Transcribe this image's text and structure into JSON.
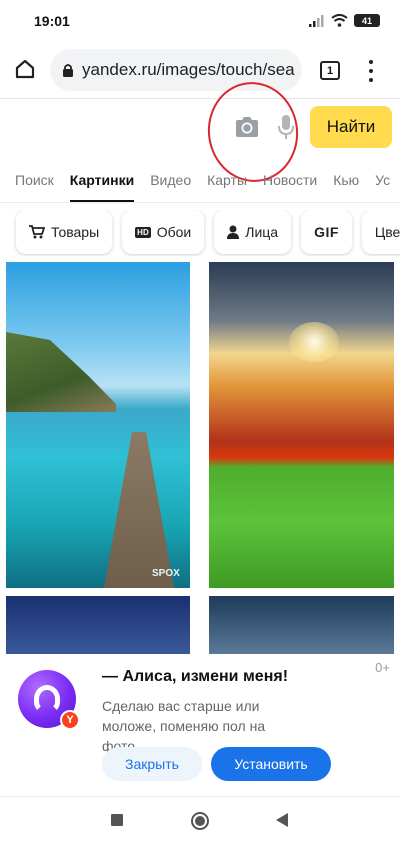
{
  "status_bar": {
    "time": "19:01",
    "battery": "41",
    "icons": [
      "signal-icon",
      "wifi-icon",
      "battery-icon"
    ]
  },
  "browser": {
    "url": "yandex.ru/images/touch/sea",
    "tabs_count": "1",
    "icons": [
      "home-icon",
      "lock-icon",
      "tabs-icon",
      "menu-icon"
    ]
  },
  "search": {
    "query": "",
    "find_label": "Найти",
    "icons": [
      "camera-icon",
      "microphone-icon"
    ],
    "accent_color": "#ffdb4d"
  },
  "nav_tabs": [
    {
      "label": "Поиск",
      "active": false
    },
    {
      "label": "Картинки",
      "active": true
    },
    {
      "label": "Видео",
      "active": false
    },
    {
      "label": "Карты",
      "active": false
    },
    {
      "label": "Новости",
      "active": false
    },
    {
      "label": "Кью",
      "active": false
    },
    {
      "label": "Ус",
      "active": false
    }
  ],
  "filter_chips": [
    {
      "label": "Товары",
      "icon": "cart-icon"
    },
    {
      "label": "Обои",
      "icon": "hd-icon"
    },
    {
      "label": "Лица",
      "icon": "person-icon"
    },
    {
      "label": "GIF",
      "icon": ""
    },
    {
      "label": "Цвета",
      "icon": ""
    }
  ],
  "images": {
    "tile_1_watermark": "SPOX"
  },
  "promo": {
    "counter": "0+",
    "title": "— Алиса, измени меня!",
    "description": "Сделаю вас старше или моложе, поменяю пол на фото",
    "close_label": "Закрыть",
    "install_label": "Установить",
    "install_color": "#1a73e8"
  }
}
